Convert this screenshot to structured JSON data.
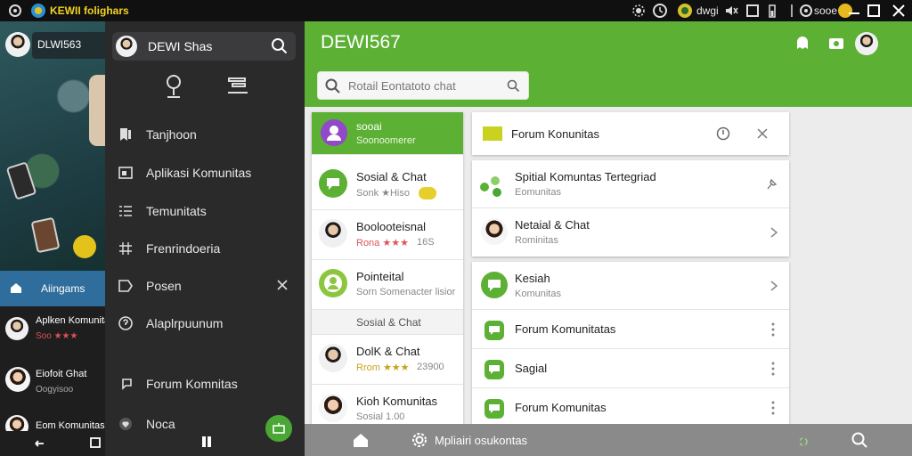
{
  "topbar": {
    "app_title": "KEWII folighars",
    "right_labels": [
      "dwgi",
      "sooe"
    ]
  },
  "left_list": {
    "header": "Aiingams",
    "items": [
      {
        "title": "Aplken Komunitas",
        "sub": "Soo ★★★"
      },
      {
        "title": "Eiofoit Ghat",
        "sub": "Oogyisoo"
      },
      {
        "title": "Eom Komunitas",
        "sub": ""
      }
    ],
    "profile_name": "DLWI563"
  },
  "drawer": {
    "search_value": "DEWI Shas",
    "items": [
      {
        "label": "Tanjhoon",
        "icon": "bookmark-icon"
      },
      {
        "label": "Aplikasi Komunitas",
        "icon": "window-icon"
      },
      {
        "label": "Temunitats",
        "icon": "list-icon"
      },
      {
        "label": "Frenrindoeria",
        "icon": "grid-icon"
      },
      {
        "label": "Posen",
        "icon": "tag-icon"
      },
      {
        "label": "Alaplrpuunum",
        "icon": "help-icon"
      },
      {
        "label": "Forum Komnitas",
        "icon": "chat-icon"
      },
      {
        "label": "Noca",
        "icon": "heart-icon"
      }
    ]
  },
  "appbar": {
    "title": "DEWI567",
    "search_placeholder": "Rotail Eontatoto chat"
  },
  "chat_list": {
    "active": {
      "title": "sooai",
      "sub": "Soonoomerer"
    },
    "items": [
      {
        "title": "Sosial & Chat",
        "sub": "Sonk ★Hiso"
      },
      {
        "title": "Boolooteisnal",
        "sub": "Rona ★★★",
        "meta": "16S"
      },
      {
        "title": "Pointeital",
        "sub": "Sorn Somenacter lisior"
      }
    ],
    "section_header": "Sosial & Chat",
    "items2": [
      {
        "title": "DolK & Chat",
        "sub": "Rrom ★★★",
        "meta": "23900"
      },
      {
        "title": "Kioh Komunitas",
        "sub": "Sosial 1.00"
      }
    ]
  },
  "forum_header": {
    "title": "Forum Konunitas"
  },
  "forum_items": [
    {
      "title": "Spitial Komuntas Tertegriad",
      "sub": "Eomunitas"
    },
    {
      "title": "Netaial & Chat",
      "sub": "Rominitas"
    }
  ],
  "forum_items2": [
    {
      "title": "Kesiah",
      "sub": "Komunitas"
    },
    {
      "title": "Forum Komunitatas",
      "sub": ""
    },
    {
      "title": "Sagial",
      "sub": ""
    },
    {
      "title": "Forum Komunitas",
      "sub": ""
    }
  ],
  "navbar": {
    "center_label": "Mpliairi osukontas"
  },
  "colors": {
    "accent": "#5cb135",
    "drawer": "#2a2a2b",
    "left_header": "#2e6d9c"
  }
}
